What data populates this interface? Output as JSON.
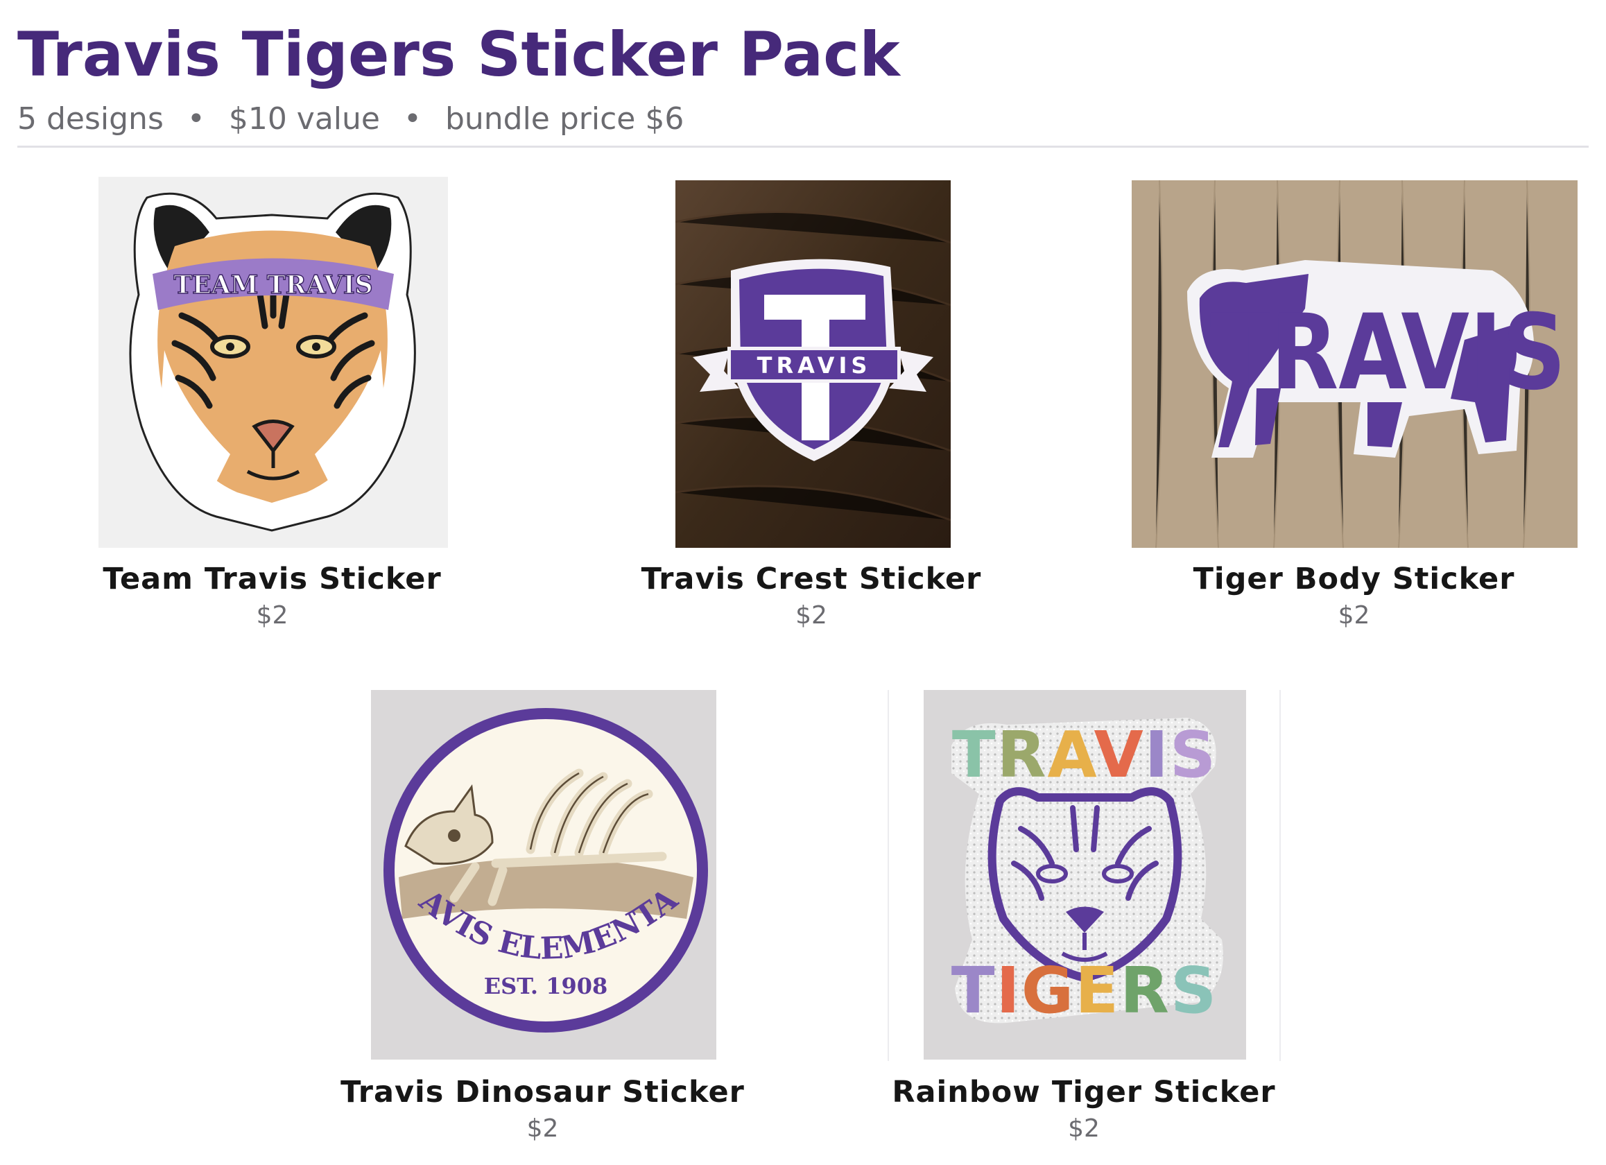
{
  "header": {
    "title": "Travis Tigers Sticker Pack",
    "designs": "5 designs",
    "value": "$10 value",
    "bundle": "bundle price $6",
    "separator": "•"
  },
  "colors": {
    "brand_purple": "#46297a",
    "sticker_purple": "#5b3b9a",
    "muted_text": "#6b6b70"
  },
  "products": [
    {
      "name": "Team Travis Sticker",
      "price": "$2",
      "art_text": "TEAM TRAVIS",
      "icon": "tiger-head-icon"
    },
    {
      "name": "Travis Crest Sticker",
      "price": "$2",
      "art_text": "TRAVIS",
      "icon": "crest-icon"
    },
    {
      "name": "Tiger Body Sticker",
      "price": "$2",
      "art_text": "TRAVIS",
      "icon": "tiger-body-icon"
    },
    {
      "name": "Travis Dinosaur Sticker",
      "price": "$2",
      "art_text": "TRAVIS ELEMENTARY",
      "art_subtext": "EST. 1908",
      "icon": "dinosaur-skeleton-icon"
    },
    {
      "name": "Rainbow Tiger Sticker",
      "price": "$2",
      "art_text": "TRAVIS",
      "art_subtext": "TIGERS",
      "icon": "rainbow-tiger-icon"
    }
  ]
}
